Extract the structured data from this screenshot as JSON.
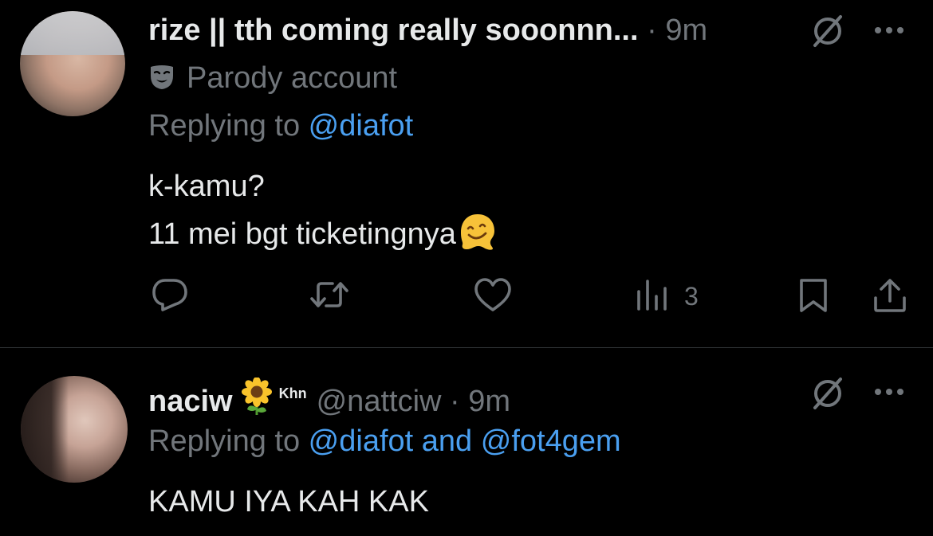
{
  "tweets": [
    {
      "display_name": "rize || tth coming really sooonnn...",
      "dot": " · ",
      "time": "9m",
      "parody_label": "Parody account",
      "replying_prefix": "Replying to ",
      "mentions": [
        "@diafot"
      ],
      "text_lines": [
        "k-kamu?",
        "11 mei bgt ticketingnya"
      ],
      "actions": {
        "views_count": "3"
      },
      "icons": [
        "grok-icon",
        "more-icon",
        "mask-icon",
        "melting-face-emoji",
        "reply-icon",
        "retweet-icon",
        "like-icon",
        "views-icon",
        "bookmark-icon",
        "share-icon"
      ]
    },
    {
      "display_name": "naciw",
      "badge_text": "Khn",
      "handle": "@nattciw",
      "dot": " · ",
      "time": "9m",
      "replying_prefix": "Replying to ",
      "mentions": [
        "@diafot",
        "@fot4gem"
      ],
      "mention_joiner": " and ",
      "text_lines": [
        "KAMU IYA KAH KAK"
      ],
      "icons": [
        "sunflower-emoji",
        "grok-icon",
        "more-icon"
      ]
    }
  ],
  "colors": {
    "background": "#000000",
    "text_primary": "#e7e9ea",
    "text_secondary": "#71767b",
    "mention": "#4a9ff0",
    "divider": "#2f3336"
  }
}
